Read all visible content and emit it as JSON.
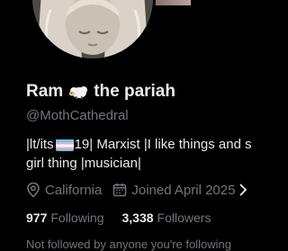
{
  "profile": {
    "display_name_part1": "Ram",
    "display_name_emoji": "sheep-emoji",
    "display_name_part2": "the pariah",
    "handle": "@MothCathedral",
    "bio_line1_pre": "|lt/its",
    "bio_flag": "transgender-flag-emoji",
    "bio_line1_post": "19| Marxist |I like things and s",
    "bio_line2": "girl thing |musician|",
    "location": "California",
    "joined": "Joined April 2025",
    "following_count": "977",
    "following_label": "Following",
    "followers_count": "3,338",
    "followers_label": "Followers",
    "followed_by": "Not followed by anyone you're following"
  },
  "icons": {
    "location": "location-pin-icon",
    "calendar": "calendar-icon",
    "chevron": "chevron-right-icon"
  },
  "colors": {
    "background": "#000000",
    "primary_text": "#e7e9ea",
    "secondary_text": "#71767b"
  }
}
